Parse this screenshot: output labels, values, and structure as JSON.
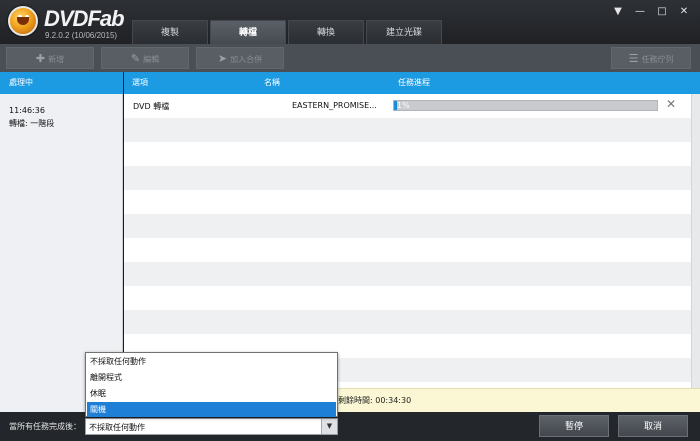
{
  "app": {
    "name": "DVDFab",
    "version": "9.2.0.2 (10/06/2015)"
  },
  "tabs": [
    "複製",
    "轉檔",
    "轉換",
    "建立光碟"
  ],
  "active_tab_index": 1,
  "window_controls": {
    "menu": "▼",
    "minimize": "—",
    "maximize": "□",
    "close": "✕"
  },
  "toolbar": {
    "add": "新增",
    "edit": "編輯",
    "join": "加入合併",
    "queue": "任務佇列"
  },
  "columns": {
    "left": "處理中",
    "option": "選項",
    "name": "名稱",
    "progress": "任務進程"
  },
  "processing": {
    "time": "11:46:36",
    "stage": "轉檔: 一階段"
  },
  "tasks": [
    {
      "option": "DVD 轉檔",
      "name": "EASTERN_PROMISE...",
      "progress_percent": 1,
      "progress_label": "1%"
    }
  ],
  "info": {
    "remaining_label": "剩餘時間:",
    "remaining_value": "00:34:30"
  },
  "bottom": {
    "after_label": "當所有任務完成後：",
    "select_value": "不採取任何動作",
    "pause": "暫停",
    "cancel": "取消"
  },
  "dropdown_options": [
    "不採取任何動作",
    "離開程式",
    "休眠",
    "關機"
  ],
  "dropdown_highlighted_index": 3,
  "colors": {
    "accent": "#1d9be2",
    "progress": "#1a8fd8",
    "info_bar": "#fbf7d4",
    "dark_bg": "#23262a"
  }
}
